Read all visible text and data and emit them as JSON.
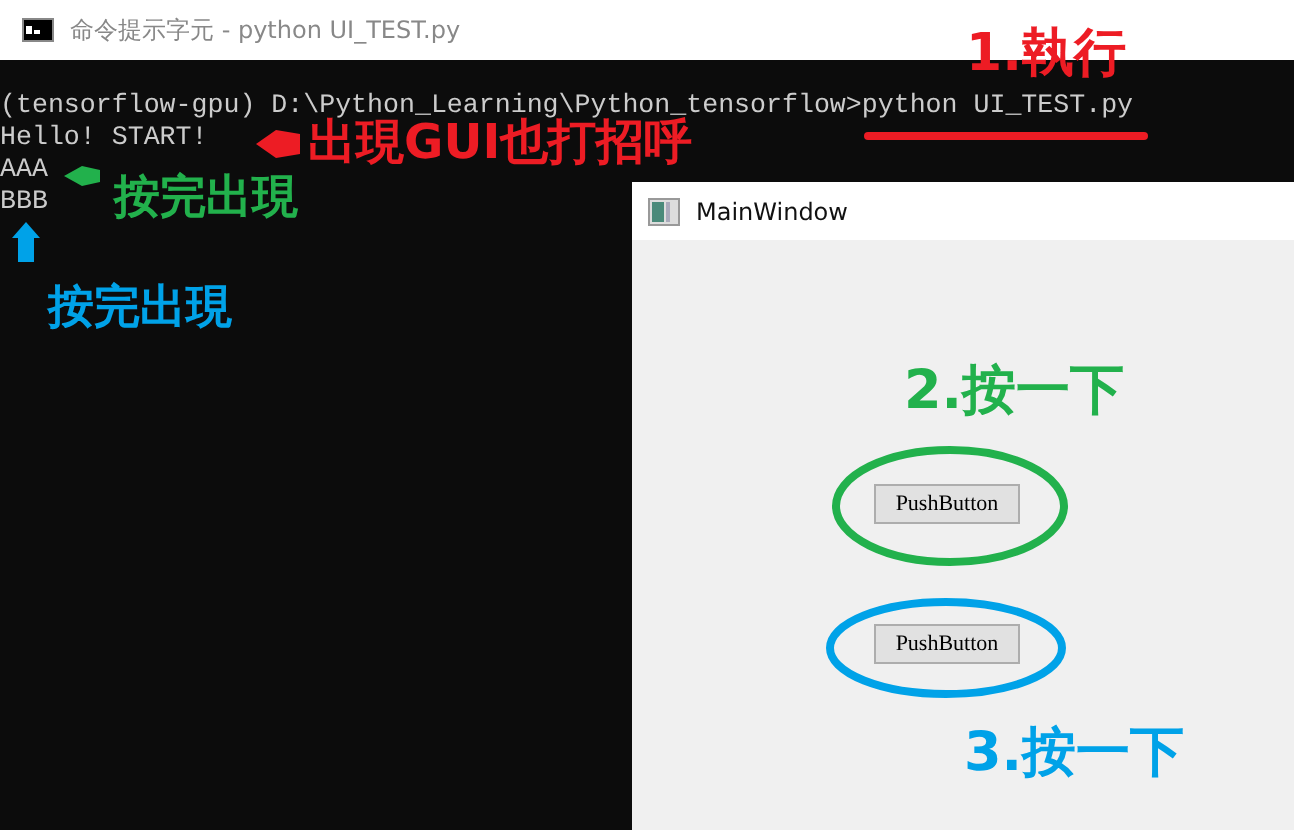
{
  "console": {
    "title": "命令提示字元 - python  UI_TEST.py",
    "lines": [
      "(tensorflow-gpu) D:\\Python_Learning\\Python_tensorflow>python UI_TEST.py",
      "Hello!  START!",
      "AAA",
      "BBB"
    ]
  },
  "main_window": {
    "title": "MainWindow",
    "buttons": [
      "PushButton",
      "PushButton"
    ]
  },
  "annotations": [
    {
      "text": "1.執行",
      "color": "#ed1c24"
    },
    {
      "text": "出現GUI也打招呼",
      "color": "#ed1c24"
    },
    {
      "text": "按完出現",
      "color": "#22b14c"
    },
    {
      "text": "按完出現",
      "color": "#00a2e8"
    },
    {
      "text": "2.按一下",
      "color": "#22b14c"
    },
    {
      "text": "3.按一下",
      "color": "#00a2e8"
    }
  ]
}
